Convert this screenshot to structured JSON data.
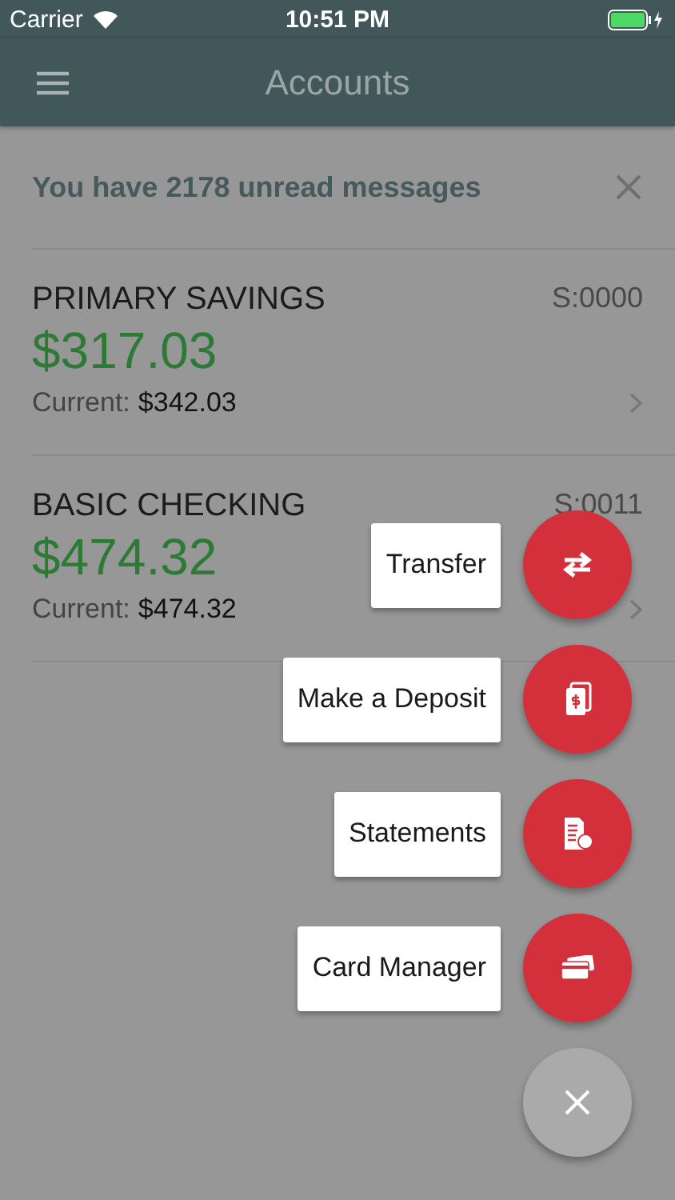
{
  "status_bar": {
    "carrier": "Carrier",
    "time": "10:51 PM"
  },
  "header": {
    "title": "Accounts"
  },
  "banner": {
    "text": "You have 2178 unread messages"
  },
  "accounts": [
    {
      "name": "PRIMARY SAVINGS",
      "number": "S:0000",
      "balance": "$317.03",
      "current_label": "Current:",
      "current_value": "$342.03"
    },
    {
      "name": "BASIC CHECKING",
      "number": "S:0011",
      "balance": "$474.32",
      "current_label": "Current:",
      "current_value": "$474.32"
    }
  ],
  "fab_menu": {
    "actions": [
      {
        "label": "Transfer",
        "kind": "transfer"
      },
      {
        "label": "Make a Deposit",
        "kind": "deposit"
      },
      {
        "label": "Statements",
        "kind": "statements"
      },
      {
        "label": "Card Manager",
        "kind": "card"
      }
    ]
  }
}
